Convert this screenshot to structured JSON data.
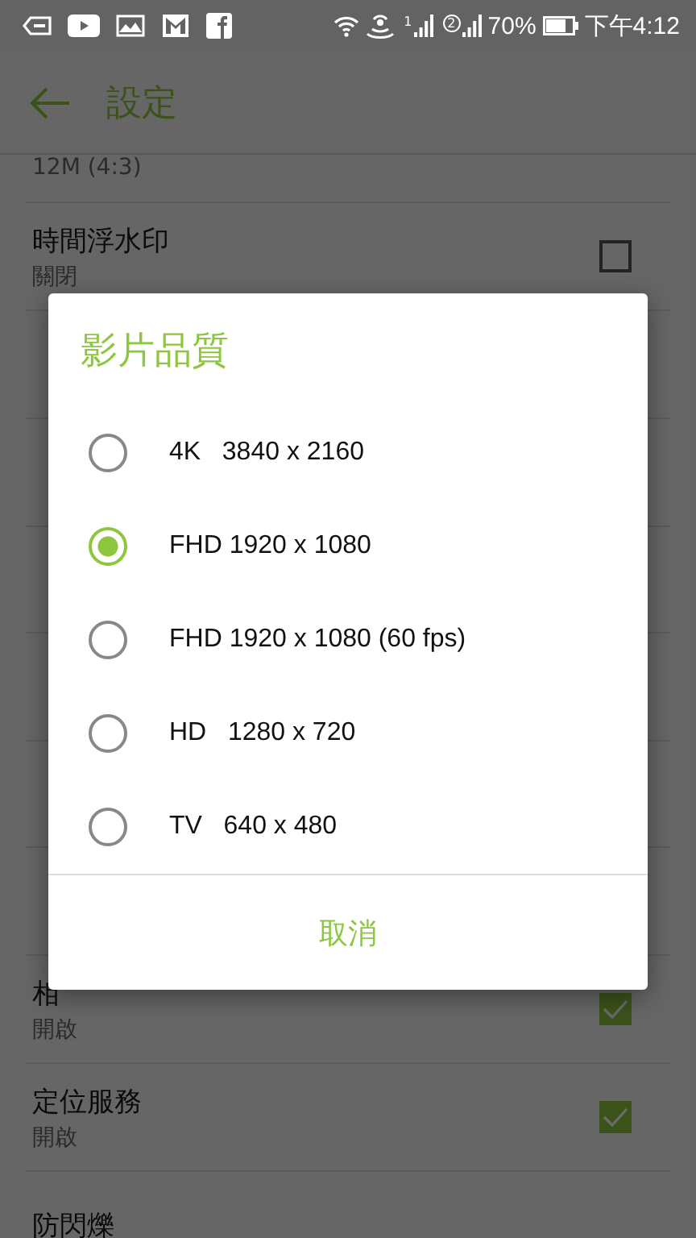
{
  "status_bar": {
    "sim_1": "1",
    "sim_2": "2",
    "battery": "70%",
    "time": "下午4:12"
  },
  "toolbar": {
    "title": "設定"
  },
  "settings": [
    {
      "kind": "row",
      "subtitle": "12M (4:3)"
    },
    {
      "kind": "row",
      "title": "時間浮水印",
      "subtitle": "關閉",
      "checked": false
    },
    {
      "kind": "row"
    },
    {
      "kind": "row"
    },
    {
      "kind": "header"
    },
    {
      "kind": "row"
    },
    {
      "kind": "header"
    },
    {
      "kind": "row"
    },
    {
      "kind": "row",
      "title": "相",
      "subtitle": "開啟",
      "checked": true
    },
    {
      "kind": "row",
      "title": "定位服務",
      "subtitle": "開啟",
      "checked": true
    },
    {
      "kind": "row",
      "title": "防閃爍"
    }
  ],
  "dialog": {
    "title": "影片品質",
    "options": [
      {
        "label": "4K   3840 x 2160",
        "selected": false
      },
      {
        "label": "FHD 1920 x 1080",
        "selected": true
      },
      {
        "label": "FHD 1920 x 1080 (60 fps)",
        "selected": false
      },
      {
        "label": "HD   1280 x 720",
        "selected": false
      },
      {
        "label": "TV   640 x 480",
        "selected": false
      }
    ],
    "cancel": "取消"
  }
}
